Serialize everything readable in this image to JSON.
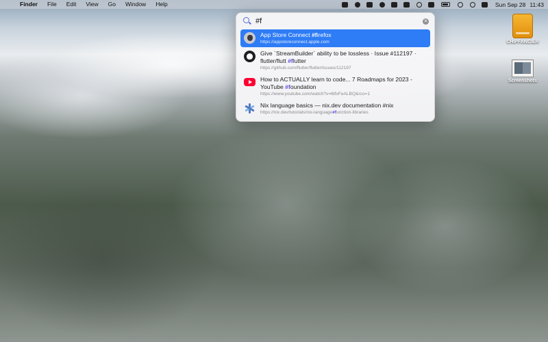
{
  "menubar": {
    "apple_symbol": "",
    "app_name": "Finder",
    "menus": [
      "File",
      "Edit",
      "View",
      "Go",
      "Window",
      "Help"
    ],
    "status_icons": [
      "stack-icon",
      "cat-icon",
      "clipboard-icon",
      "x-circle-icon",
      "m-box-icon",
      "contacts-icon",
      "timer-icon",
      "a-box-icon",
      "battery-icon",
      "wifi-icon",
      "search-icon",
      "control-center-icon"
    ],
    "date": "Sun Sep 28",
    "time": "11:43"
  },
  "desktop": {
    "icons": [
      {
        "label": "CHIPFANCIER",
        "icon": "external-drive-icon"
      },
      {
        "label": "Screenshots",
        "icon": "folder-screenshots-icon"
      }
    ]
  },
  "search": {
    "query": "#f",
    "results": [
      {
        "icon": "apple-icon",
        "title_pre": "App Store Connect ",
        "title_hl": "#f",
        "title_post": "irefox",
        "title2_pre": "",
        "title2_hl": "",
        "title2_post": "",
        "url": "https://appstoreconnect.apple.com",
        "selected": true
      },
      {
        "icon": "github-icon",
        "title_pre": "Give `StreamBuilder` ability to be lossless · Issue #112197 ·",
        "title_hl": "",
        "title_post": "",
        "title2_pre": "flutter/flutt ",
        "title2_hl": "#f",
        "title2_post": "lutter",
        "url": "https://github.com/flutter/flutter/issues/112197",
        "selected": false
      },
      {
        "icon": "youtube-icon",
        "title_pre": "How to ACTUALLY learn to code... 7 Roadmaps for 2023 -",
        "title_hl": "",
        "title_post": "",
        "title2_pre": "YouTube ",
        "title2_hl": "#f",
        "title2_post": "oundation",
        "url": "https://www.youtube.com/watch?v=6tfvFeALBQ&rco=1",
        "selected": false
      },
      {
        "icon": "nix-icon",
        "title_pre": "Nix language basics — nix.dev documentation #nix",
        "title_hl": "",
        "title_post": "",
        "title2_pre": "",
        "title2_hl": "",
        "title2_post": "",
        "url_pre": "https://nix.dev/tutorials/nix-language",
        "url_hl": "#f",
        "url_post": "unction-libraries",
        "selected": false
      }
    ]
  },
  "colors": {
    "accent": "#2e7cf6",
    "highlight": "#5b4ce0"
  }
}
